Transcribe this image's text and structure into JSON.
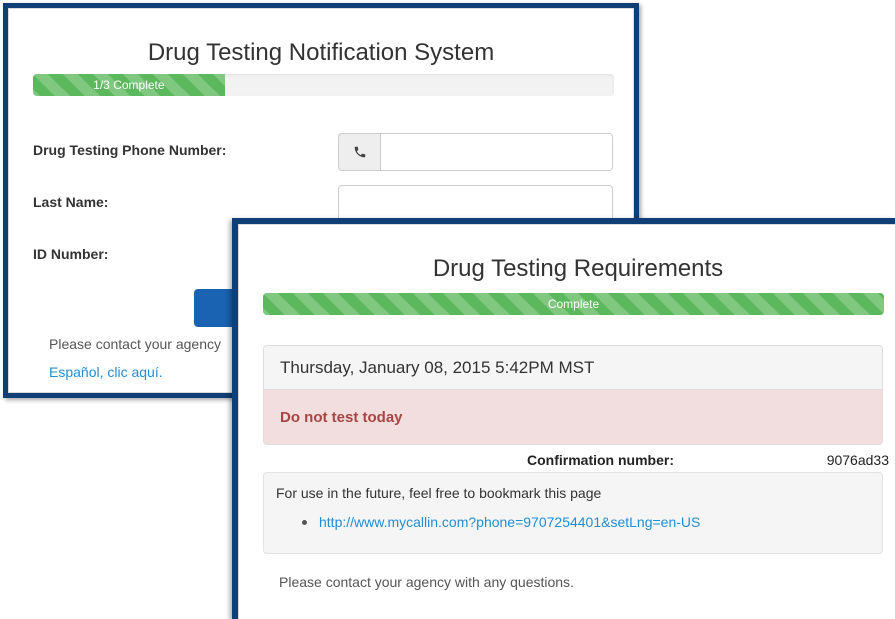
{
  "back": {
    "title": "Drug Testing Notification System",
    "progress": {
      "label": "1/3 Complete",
      "fraction": 0.33
    },
    "labels": {
      "phone": "Drug Testing Phone Number:",
      "last_name": "Last Name:",
      "id_number": "ID Number:"
    },
    "contact": "Please contact your agency",
    "spanish_link": "Español, clic aquí."
  },
  "front": {
    "title": "Drug Testing Requirements",
    "progress": {
      "label": "Complete",
      "fraction": 1.0
    },
    "datetime": "Thursday, January 08, 2015 5:42PM MST",
    "alert": "Do not test today",
    "confirmation_label": "Confirmation number:",
    "confirmation_value": "9076ad33",
    "bookmark_text": "For use in the future, feel free to bookmark this page",
    "bookmark_link": "http://www.mycallin.com?phone=9707254401&setLng=en-US",
    "contact": "Please contact your agency with any questions."
  },
  "icons": {
    "phone": "phone-icon"
  },
  "colors": {
    "frame": "#0f3f76",
    "progress": "#5cb85c",
    "alert_bg": "#f2dede",
    "alert_text": "#a94442",
    "link": "#1f8ed6",
    "button": "#1a63b3"
  }
}
